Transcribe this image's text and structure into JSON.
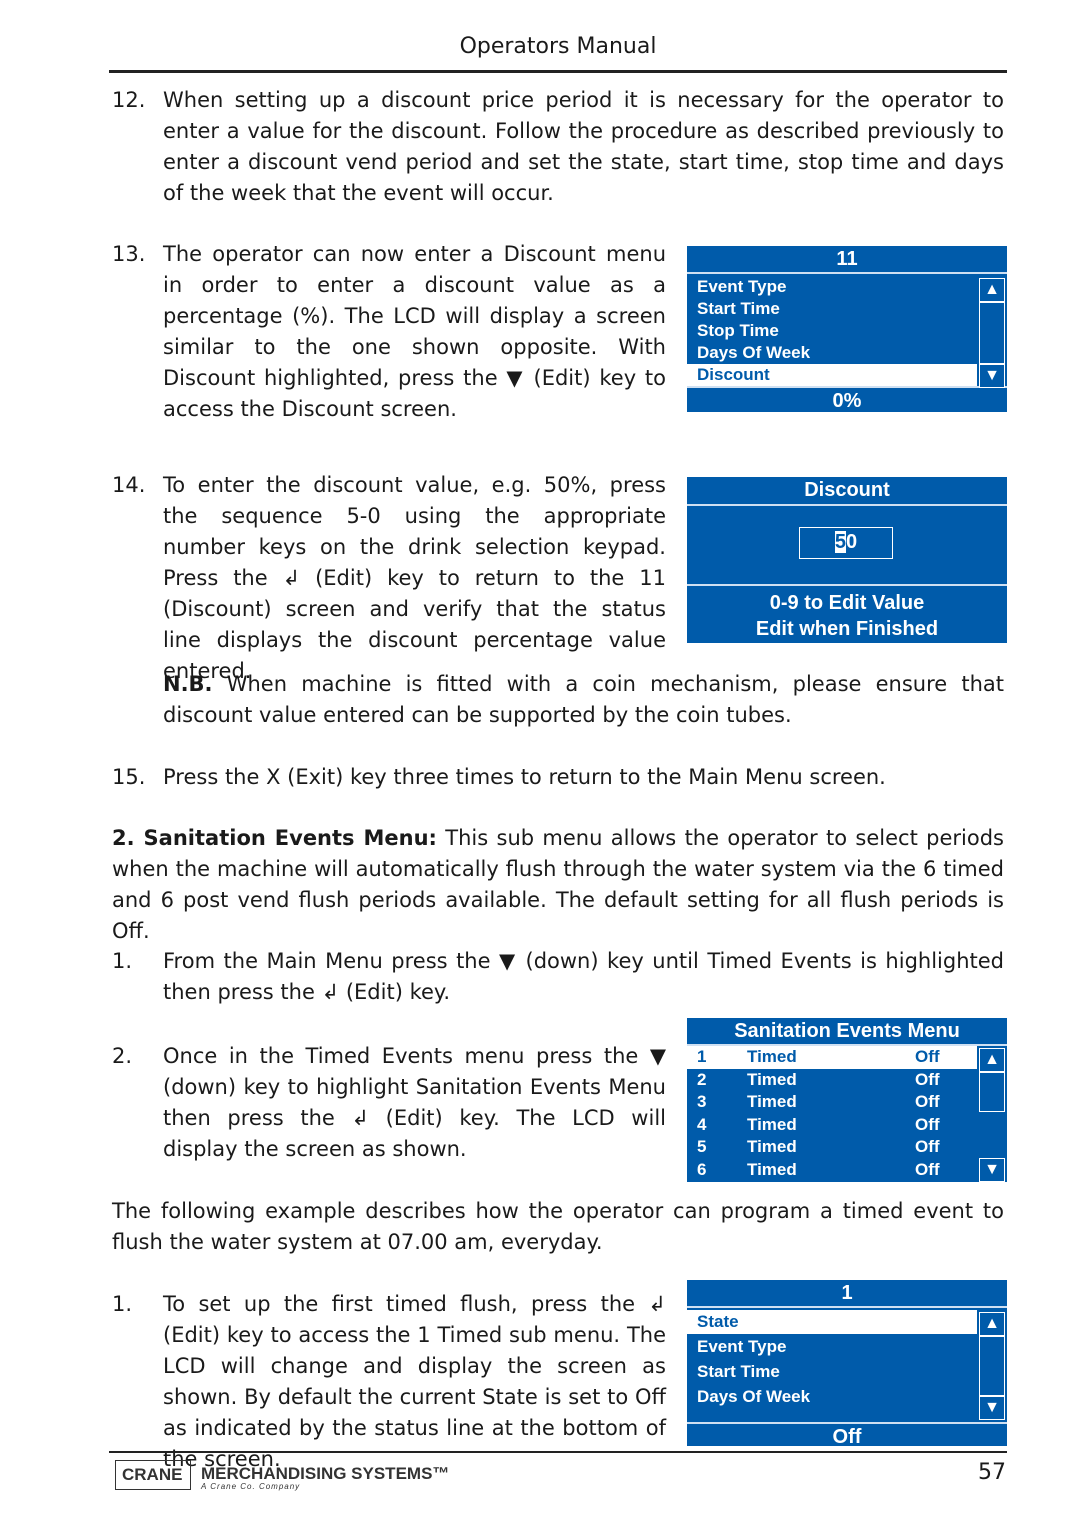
{
  "header": {
    "title": "Operators Manual"
  },
  "items": [
    {
      "num": "12.",
      "text": "When setting up a discount price period it is necessary for the operator to enter a value for the discount. Follow the procedure as described previously to enter a discount vend period and set the state, start time, stop time and days of the week that the event will occur."
    },
    {
      "num": "13.",
      "text": "The operator can now enter a Discount menu in order to enter a discount value as a percentage (%). The LCD will display a screen similar to the one shown opposite. With Discount highlighted, press the ▼ (Edit) key to access the Discount screen."
    },
    {
      "num": "14.",
      "text": "To enter the discount value, e.g. 50%, press the sequence 5-0 using the appropriate number keys on the drink selection keypad. Press the ↲ (Edit) key to return to the 11 (Discount) screen and verify that the status line displays the discount percentage value entered."
    },
    {
      "nb_label": "N.B.",
      "text": "When machine is fitted with a coin mechanism, please ensure that discount value entered can be supported by the coin tubes."
    },
    {
      "num": "15.",
      "text": "Press the X (Exit) key three times to return to the Main Menu screen."
    }
  ],
  "section": {
    "label": "2.  Sanitation Events Menu:",
    "text": "This sub menu allows the operator to select periods when the machine will automatically flush through the water system via the 6 timed and 6 post vend flush periods available. The default setting for all flush periods is Off."
  },
  "steps": [
    {
      "num": "1.",
      "text": "From the Main Menu press the ▼ (down) key until Timed Events is highlighted then press the ↲ (Edit) key."
    },
    {
      "num": "2.",
      "text": "Once in the Timed Events menu press the ▼ (down) key to highlight Sanitation Events Menu then press the ↲ (Edit) key. The LCD will display the screen as shown."
    }
  ],
  "example": "The following example describes how the operator can program a timed event to flush the water system at 07.00 am, everyday.",
  "step3": {
    "num": "1.",
    "text": "To set up the first timed flush, press the ↲ (Edit) key to access the 1 Timed sub menu. The LCD will change and display the screen as shown. By default the current State is set to Off as indicated by the status line at the bottom of the screen."
  },
  "lcd1": {
    "title": "11",
    "rows": [
      "Event Type",
      "Start Time",
      "Stop Time",
      "Days Of Week",
      "Discount"
    ],
    "selected": 4,
    "status": "0%"
  },
  "lcd2": {
    "title": "Discount",
    "value_first": "5",
    "value_rest": "0",
    "line1": "0-9 to Edit Value",
    "line2": "Edit when Finished"
  },
  "lcd3": {
    "title": "Sanitation Events Menu",
    "rows": [
      {
        "n": "1",
        "name": "Timed",
        "state": "Off"
      },
      {
        "n": "2",
        "name": "Timed",
        "state": "Off"
      },
      {
        "n": "3",
        "name": "Timed",
        "state": "Off"
      },
      {
        "n": "4",
        "name": "Timed",
        "state": "Off"
      },
      {
        "n": "5",
        "name": "Timed",
        "state": "Off"
      },
      {
        "n": "6",
        "name": "Timed",
        "state": "Off"
      }
    ],
    "selected": 0
  },
  "lcd4": {
    "title": "1",
    "rows": [
      "State",
      "Event Type",
      "Start Time",
      "Days Of Week"
    ],
    "selected": 0,
    "status": "Off"
  },
  "footer": {
    "brand": "CRANE",
    "company": "MERCHANDISING SYSTEMS™",
    "tagline": "A Crane Co. Company",
    "page": "57"
  },
  "colors": {
    "lcd_blue": "#005BAA"
  }
}
